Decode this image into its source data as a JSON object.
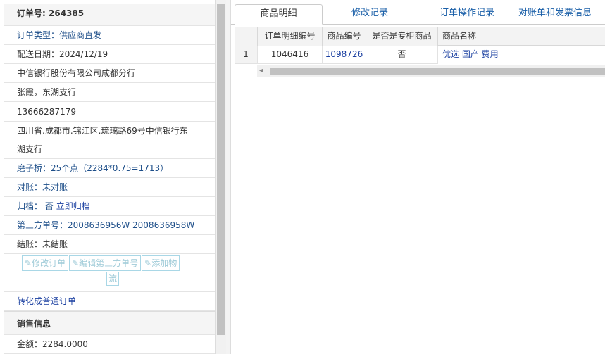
{
  "order": {
    "number_label": "订单号:",
    "number_value": "264385",
    "type": "订单类型：供应商直发",
    "delivery_date": "配送日期：2024/12/19",
    "company": "中信银行股份有限公司成都分行",
    "contact": "张霞，东湖支行",
    "phone": "13666287179",
    "address_line1": "四川省.成都市.锦江区.琉璃路69号中信银行东",
    "address_line2": "湖支行",
    "mozi_bridge": "磨子桥：25个点（2284*0.75=1713）",
    "reconcile": "对账：未对账",
    "archive_label": "归档：",
    "archive_value": "否",
    "archive_link": "立即归档",
    "third_party": "第三方单号：2008636956W 2008636958W",
    "settlement": "结账：未结账",
    "btn_edit_order": "修改订单",
    "btn_edit_third": "编辑第三方单号",
    "btn_add_logistics_1": "添加物",
    "btn_add_logistics_2": "流",
    "convert_link": "转化成普通订单"
  },
  "sales": {
    "title": "销售信息",
    "amount": "金额：2284.0000"
  },
  "tabs": [
    "商品明细",
    "修改记录",
    "订单操作记录",
    "对账单和发票信息"
  ],
  "table": {
    "headers": [
      "订单明细编号",
      "商品编号",
      "是否是专柜商品",
      "商品名称"
    ],
    "rows": [
      {
        "index": "1",
        "detail_no": "1046416",
        "product_no": "1098726",
        "is_counter": "否",
        "name": "优选 国产 费用"
      }
    ]
  },
  "scroll": {
    "left_arrow": "◂"
  }
}
